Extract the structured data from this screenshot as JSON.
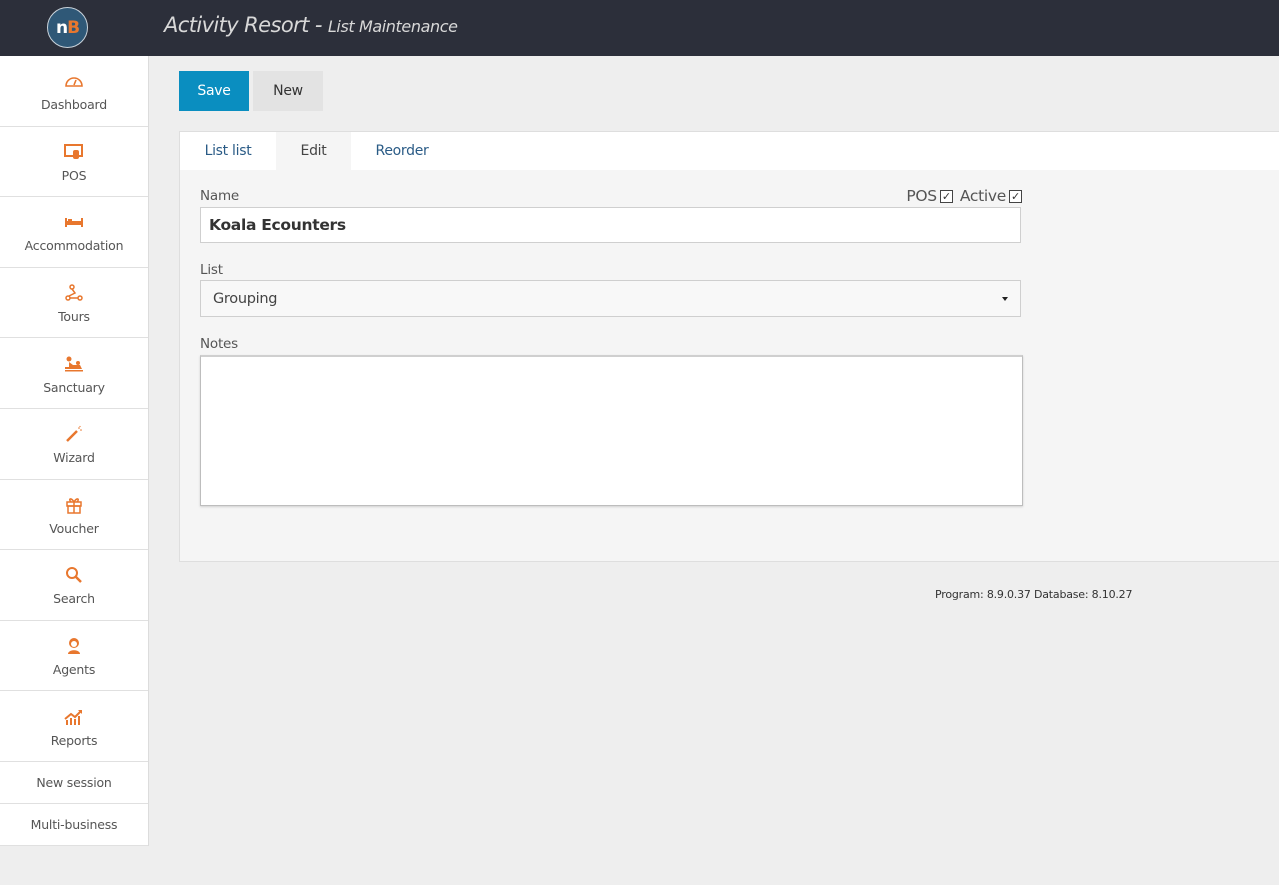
{
  "header": {
    "logo_text_n": "n",
    "logo_text_b": "B",
    "title": "Activity Resort - ",
    "subtitle": "List Maintenance"
  },
  "sidebar": {
    "items": [
      {
        "label": "Dashboard",
        "icon": "speedometer-icon"
      },
      {
        "label": "POS",
        "icon": "pos-touch-icon"
      },
      {
        "label": "Accommodation",
        "icon": "bed-icon"
      },
      {
        "label": "Tours",
        "icon": "route-icon"
      },
      {
        "label": "Sanctuary",
        "icon": "massage-icon"
      },
      {
        "label": "Wizard",
        "icon": "magic-wand-icon"
      },
      {
        "label": "Voucher",
        "icon": "gift-icon"
      },
      {
        "label": "Search",
        "icon": "search-icon"
      },
      {
        "label": "Agents",
        "icon": "agent-icon"
      },
      {
        "label": "Reports",
        "icon": "chart-trend-icon"
      }
    ],
    "text_items": [
      {
        "label": "New session"
      },
      {
        "label": "Multi-business"
      }
    ]
  },
  "toolbar": {
    "save_label": "Save",
    "new_label": "New"
  },
  "tabs": [
    {
      "label": "List list",
      "active": false
    },
    {
      "label": "Edit",
      "active": true
    },
    {
      "label": "Reorder",
      "active": false
    }
  ],
  "form": {
    "name_label": "Name",
    "name_value": "Koala Ecounters",
    "pos_label": "POS",
    "pos_checked": true,
    "active_label": "Active",
    "active_checked": true,
    "list_label": "List",
    "list_value": "Grouping",
    "notes_label": "Notes",
    "notes_value": ""
  },
  "footer": {
    "version": "Program: 8.9.0.37 Database: 8.10.27"
  },
  "colors": {
    "accent": "#0a8ec0",
    "icon": "#e8772e",
    "topbar": "#2c2f3a"
  }
}
